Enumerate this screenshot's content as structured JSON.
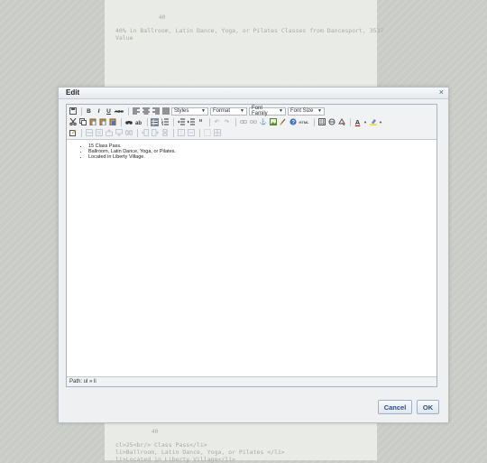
{
  "background": {
    "top_small": "40",
    "top_line1": "40% in Ballroom, Latin Dance, Yoga, or Pilates Classes from Dancesport, 3537",
    "top_line2": "Value",
    "bottom_small": "40",
    "bottom_line1": "cl>25<br/> Class Pass</li>",
    "bottom_line2": "li>Ballroom, Latin Dance, Yoga, or Pilates </li>",
    "bottom_line3": "li>Located in Liberty Village</li>"
  },
  "dialog": {
    "title": "Edit",
    "close_glyph": "×"
  },
  "toolbar": {
    "styles_label": "Styles",
    "format_label": "Format",
    "font_family_label": "Font Family",
    "font_size_label": "Font Size",
    "bold": "B",
    "italic": "I",
    "underline": "U",
    "strike": "ABC",
    "html_label": "HTML"
  },
  "content": {
    "items": [
      "15 Class Pass.",
      "Ballroom, Latin Dance, Yoga, or Pilates.",
      "Located in Liberty Village."
    ]
  },
  "status": {
    "path": "Path: ul » li"
  },
  "buttons": {
    "cancel": "Cancel",
    "ok": "OK"
  },
  "colors": {
    "accent": "#2c4f7e",
    "backdrop": "#c9ccc6"
  }
}
